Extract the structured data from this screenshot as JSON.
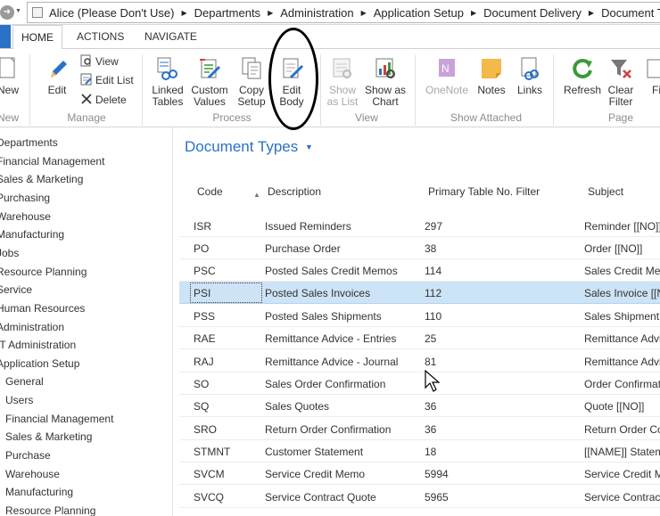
{
  "address": {
    "user": "Alice (Please Don't Use)",
    "crumbs": [
      "Departments",
      "Administration",
      "Application Setup",
      "Document Delivery",
      "Document Types"
    ]
  },
  "ribbon_tabs": [
    "HOME",
    "ACTIONS",
    "NAVIGATE"
  ],
  "ribbon": {
    "new": "New",
    "edit": "Edit",
    "view": "View",
    "edit_list": "Edit List",
    "delete": "Delete",
    "linked_tables": [
      "Linked",
      "Tables"
    ],
    "custom_values": [
      "Custom",
      "Values"
    ],
    "copy_setup": [
      "Copy",
      "Setup"
    ],
    "edit_body": [
      "Edit",
      "Body"
    ],
    "show_as_list": [
      "Show",
      "as List"
    ],
    "show_as_chart": [
      "Show as",
      "Chart"
    ],
    "onenote": "OneNote",
    "notes": "Notes",
    "links": "Links",
    "refresh": "Refresh",
    "clear_filter": [
      "Clear",
      "Filter"
    ],
    "find": "Fi",
    "groups": {
      "new": "New",
      "manage": "Manage",
      "process": "Process",
      "view": "View",
      "show_attached": "Show Attached",
      "page": "Page"
    }
  },
  "left_nav": [
    {
      "label": "Departments",
      "level": 0
    },
    {
      "label": "Financial Management",
      "level": 0
    },
    {
      "label": "Sales & Marketing",
      "level": 0
    },
    {
      "label": "Purchasing",
      "level": 0
    },
    {
      "label": "Warehouse",
      "level": 0
    },
    {
      "label": "Manufacturing",
      "level": 0
    },
    {
      "label": "Jobs",
      "level": 0
    },
    {
      "label": "Resource Planning",
      "level": 0
    },
    {
      "label": "Service",
      "level": 0
    },
    {
      "label": "Human Resources",
      "level": 0
    },
    {
      "label": "Administration",
      "level": 0
    },
    {
      "label": "IT Administration",
      "level": 0
    },
    {
      "label": "Application Setup",
      "level": 0
    },
    {
      "label": "General",
      "level": 1
    },
    {
      "label": "Users",
      "level": 1
    },
    {
      "label": "Financial Management",
      "level": 1
    },
    {
      "label": "Sales & Marketing",
      "level": 1
    },
    {
      "label": "Purchase",
      "level": 1
    },
    {
      "label": "Warehouse",
      "level": 1
    },
    {
      "label": "Manufacturing",
      "level": 1
    },
    {
      "label": "Resource Planning",
      "level": 1
    }
  ],
  "page_title": "Document Types",
  "columns": [
    "Code",
    "Description",
    "Primary Table No. Filter",
    "Subject"
  ],
  "rows": [
    {
      "code": "ISR",
      "description": "Issued Reminders",
      "filter": "297",
      "subject": "Reminder [[NO]]",
      "selected": false
    },
    {
      "code": "PO",
      "description": "Purchase Order",
      "filter": "38",
      "subject": "Order [[NO]]",
      "selected": false
    },
    {
      "code": "PSC",
      "description": "Posted Sales Credit Memos",
      "filter": "114",
      "subject": "Sales Credit Mem",
      "selected": false
    },
    {
      "code": "PSI",
      "description": "Posted Sales Invoices",
      "filter": "112",
      "subject": "Sales Invoice [[N",
      "selected": true
    },
    {
      "code": "PSS",
      "description": "Posted Sales Shipments",
      "filter": "110",
      "subject": "Sales Shipment",
      "selected": false
    },
    {
      "code": "RAE",
      "description": "Remittance Advice - Entries",
      "filter": "25",
      "subject": "Remittance Advi",
      "selected": false
    },
    {
      "code": "RAJ",
      "description": "Remittance Advice - Journal",
      "filter": "81",
      "subject": "Remittance Advi",
      "selected": false
    },
    {
      "code": "SO",
      "description": "Sales Order Confirmation",
      "filter": "",
      "subject": "Order Confirmat",
      "selected": false
    },
    {
      "code": "SQ",
      "description": "Sales Quotes",
      "filter": "36",
      "subject": "Quote [[NO]]",
      "selected": false
    },
    {
      "code": "SRO",
      "description": "Return Order Confirmation",
      "filter": "36",
      "subject": "Return Order Co",
      "selected": false
    },
    {
      "code": "STMNT",
      "description": "Customer Statement",
      "filter": "18",
      "subject": "[[NAME]] Statem",
      "selected": false
    },
    {
      "code": "SVCM",
      "description": "Service Credit Memo",
      "filter": "5994",
      "subject": "Service Credit M",
      "selected": false
    },
    {
      "code": "SVCQ",
      "description": "Service Contract Quote",
      "filter": "5965",
      "subject": "Service Contract",
      "selected": false
    }
  ],
  "colors": {
    "accent": "#2a72c6",
    "selected_row": "#cde3f6"
  }
}
